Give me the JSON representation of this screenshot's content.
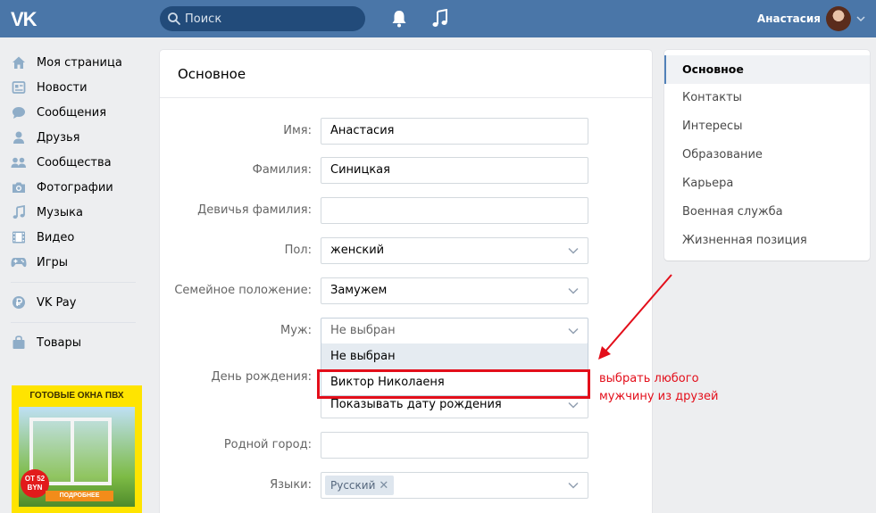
{
  "header": {
    "logo": "VK",
    "search_placeholder": "Поиск",
    "user_name": "Анастасия"
  },
  "leftnav": {
    "items": [
      {
        "label": "Моя страница",
        "icon": "home-icon"
      },
      {
        "label": "Новости",
        "icon": "news-icon"
      },
      {
        "label": "Сообщения",
        "icon": "messages-icon"
      },
      {
        "label": "Друзья",
        "icon": "friends-icon"
      },
      {
        "label": "Сообщества",
        "icon": "groups-icon"
      },
      {
        "label": "Фотографии",
        "icon": "camera-icon"
      },
      {
        "label": "Музыка",
        "icon": "music-icon"
      },
      {
        "label": "Видео",
        "icon": "video-icon"
      },
      {
        "label": "Игры",
        "icon": "gamepad-icon"
      }
    ],
    "vkpay": {
      "label": "VK Pay",
      "icon": "ruble-icon"
    },
    "goods": {
      "label": "Товары",
      "icon": "bag-icon"
    }
  },
  "ad": {
    "title": "ГОТОВЫЕ ОКНА ПВХ",
    "price_line1": "ОТ 52",
    "price_line2": "BYN",
    "button": "ПОДРОБНЕЕ"
  },
  "main": {
    "title": "Основное",
    "fields": {
      "first_name": {
        "label": "Имя:",
        "value": "Анастасия"
      },
      "last_name": {
        "label": "Фамилия:",
        "value": "Синицкая"
      },
      "maiden_name": {
        "label": "Девичья фамилия:",
        "value": ""
      },
      "gender": {
        "label": "Пол:",
        "value": "женский"
      },
      "marital": {
        "label": "Семейное положение:",
        "value": "Замужем"
      },
      "husband": {
        "label": "Муж:",
        "value": "Не выбран"
      },
      "birthday": {
        "label": "День рождения:",
        "value": "Показывать дату рождения"
      },
      "hometown": {
        "label": "Родной город:",
        "value": ""
      },
      "languages": {
        "label": "Языки:",
        "tag": "Русский"
      }
    },
    "husband_dropdown": [
      "Не выбран",
      "Виктор Николаеня"
    ]
  },
  "annotation": {
    "line1": "выбрать любого",
    "line2": "мужчину из друзей",
    "color": "#e30e1a"
  },
  "rightnav": {
    "items": [
      "Основное",
      "Контакты",
      "Интересы",
      "Образование",
      "Карьера",
      "Военная служба",
      "Жизненная позиция"
    ]
  },
  "colors": {
    "header": "#4a76a8",
    "accent": "#5181b8",
    "background": "#edeef0"
  }
}
